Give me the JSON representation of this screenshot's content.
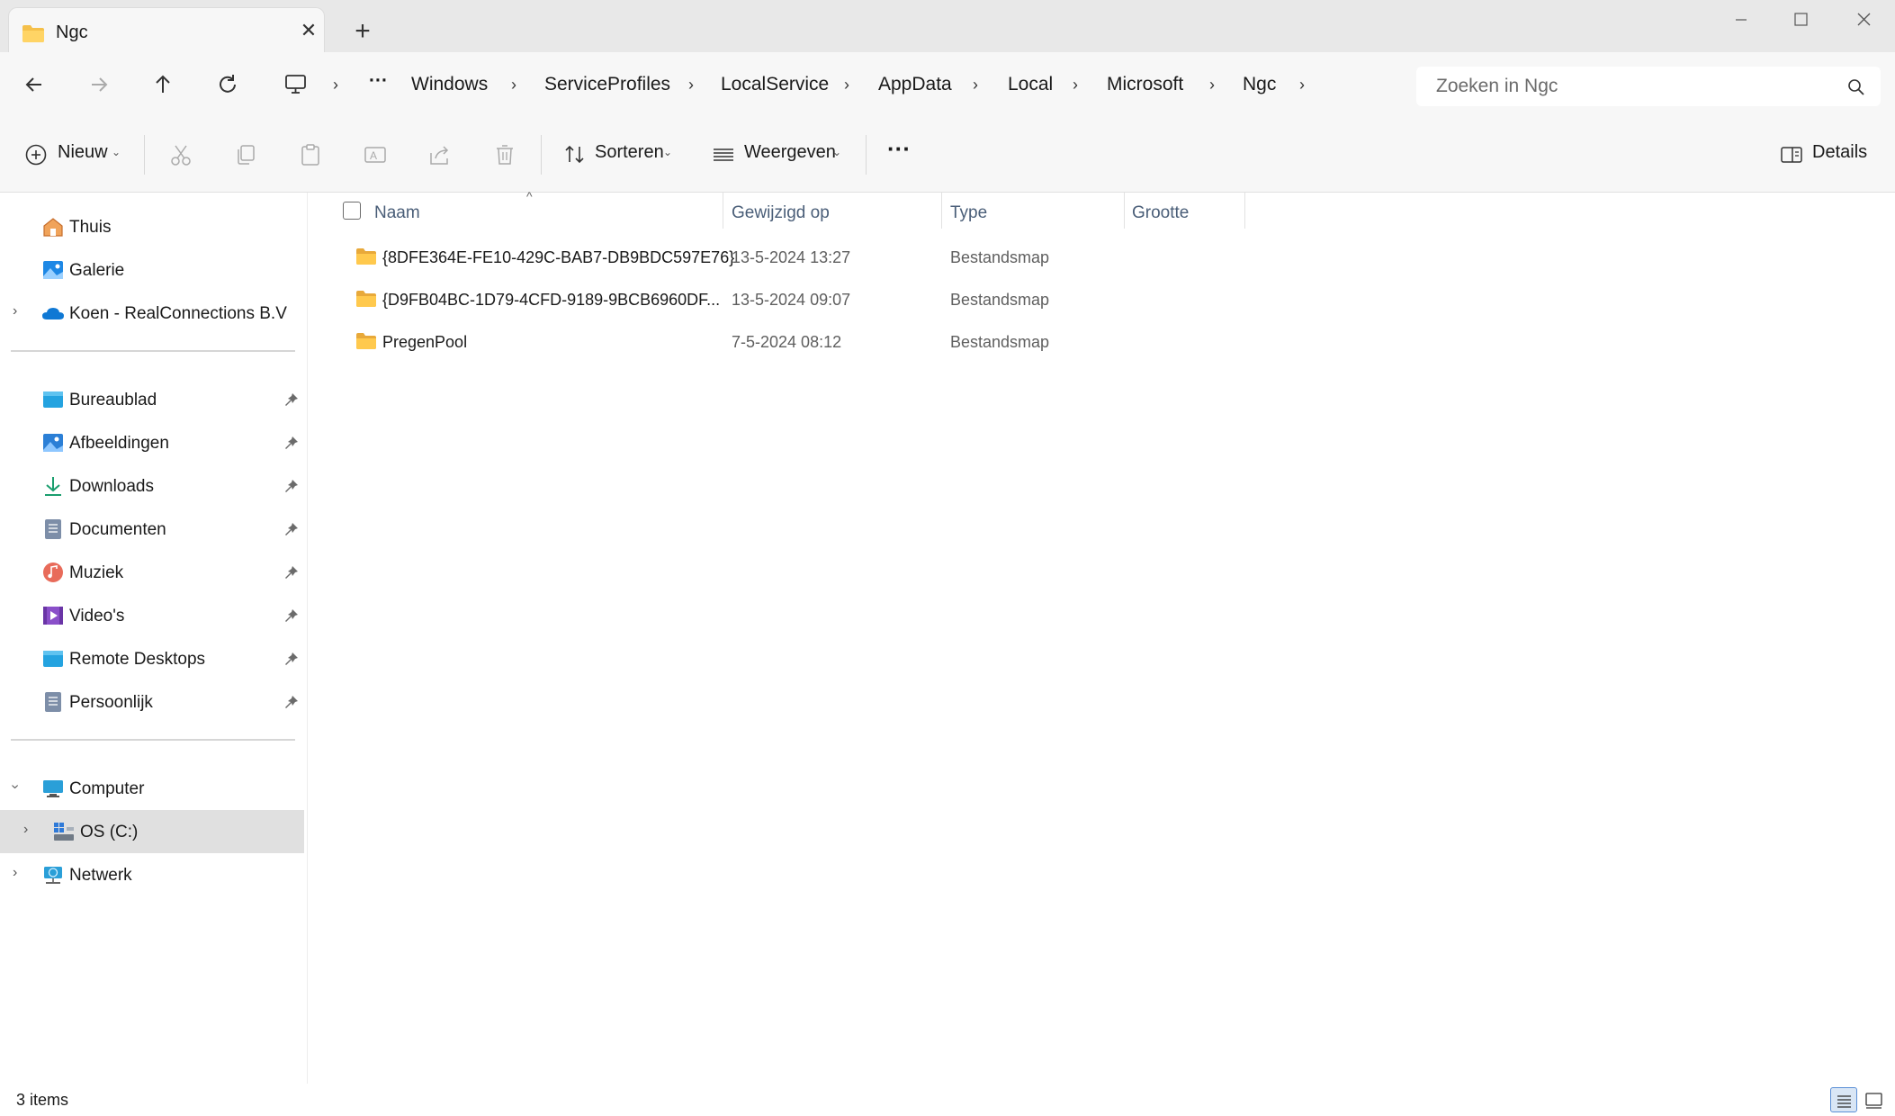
{
  "tab": {
    "title": "Ngc",
    "close": "✕",
    "new": "+"
  },
  "nav": {
    "breadcrumbs": [
      "Windows",
      "ServiceProfiles",
      "LocalService",
      "AppData",
      "Local",
      "Microsoft",
      "Ngc"
    ],
    "more": "···",
    "search_placeholder": "Zoeken in Ngc"
  },
  "commands": {
    "new": "Nieuw",
    "sort": "Sorteren",
    "view": "Weergeven",
    "more": "···",
    "details": "Details"
  },
  "sidebar": {
    "top": [
      {
        "label": "Thuis",
        "icon": "home-icon"
      },
      {
        "label": "Galerie",
        "icon": "gallery-icon"
      },
      {
        "label": "Koen - RealConnections B.V",
        "icon": "onedrive-cloud-icon"
      }
    ],
    "pinned": [
      {
        "label": "Bureaublad",
        "icon": "desktop-folder-icon"
      },
      {
        "label": "Afbeeldingen",
        "icon": "pictures-folder-icon"
      },
      {
        "label": "Downloads",
        "icon": "downloads-icon"
      },
      {
        "label": "Documenten",
        "icon": "documents-icon"
      },
      {
        "label": "Muziek",
        "icon": "music-icon"
      },
      {
        "label": "Video's",
        "icon": "videos-icon"
      },
      {
        "label": "Remote Desktops",
        "icon": "remote-desktops-icon"
      },
      {
        "label": "Persoonlijk",
        "icon": "documents-icon"
      }
    ],
    "devices": [
      {
        "label": "Computer",
        "icon": "computer-icon"
      },
      {
        "label": "OS (C:)",
        "icon": "drive-icon"
      },
      {
        "label": "Netwerk",
        "icon": "network-icon"
      }
    ]
  },
  "columns": [
    "Naam",
    "Gewijzigd op",
    "Type",
    "Grootte"
  ],
  "files": [
    {
      "name": "{8DFE364E-FE10-429C-BAB7-DB9BDC597E76}",
      "modified": "13-5-2024 13:27",
      "type": "Bestandsmap",
      "size": ""
    },
    {
      "name": "{D9FB04BC-1D79-4CFD-9189-9BCB6960DF...",
      "modified": "13-5-2024 09:07",
      "type": "Bestandsmap",
      "size": ""
    },
    {
      "name": "PregenPool",
      "modified": "7-5-2024 08:12",
      "type": "Bestandsmap",
      "size": ""
    }
  ],
  "status": {
    "count": "3 items"
  },
  "colors": {
    "folder": "#f5c04a",
    "accent": "#0067c0",
    "header_text": "#4a5e78"
  }
}
